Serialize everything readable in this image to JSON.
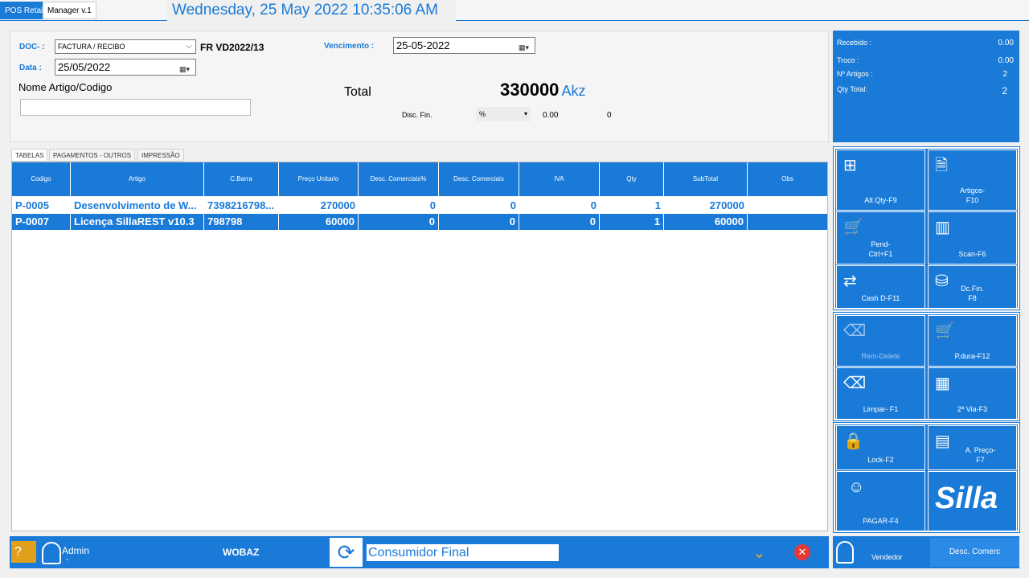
{
  "tabs": [
    "POS Retail",
    "Manager v.1"
  ],
  "clock": "Wednesday, 25 May 2022 10:35:06 AM",
  "header": {
    "doc_label": "DOC- :",
    "doc_type": "FACTURA / RECIBO",
    "doc_number": "FR VD2022/13",
    "data_label": "Data :",
    "data_value": "25/05/2022",
    "vencimento_label": "Vencimento :",
    "vencimento_value": "25-05-2022",
    "search_label": "Nome Artigo/Codigo",
    "search_value": "",
    "total_label": "Total",
    "total_value": "330000",
    "currency": "Akz",
    "disc_label": "Disc. Fin.",
    "disc_type": "%",
    "disc_pct": "0.00",
    "disc_value": "0"
  },
  "info": {
    "recebido_label": "Recebido :",
    "recebido": "0.00",
    "troco_label": "Troco :",
    "troco": "0.00",
    "artigos_label": "Nº Artigos :",
    "artigos": "2",
    "qty_label": "Qty Total:",
    "qty": "2"
  },
  "panel_tabs": [
    "TABELAS",
    "PAGAMENTOS - OUTROS",
    "IMPRESSÃO"
  ],
  "table": {
    "columns": [
      "Codigo",
      "Artigo",
      "C.Barra",
      "Preço Unitario",
      "Desc. Comerciais%",
      "Desc. Comerciais",
      "IVA",
      "Qty",
      "SubTotal",
      "Obs"
    ],
    "rows": [
      {
        "codigo": "P-0005",
        "artigo": "Desenvolvimento de W...",
        "barra": "7398216798...",
        "preco": "270000",
        "desc_pct": "0",
        "desc": "0",
        "iva": "0",
        "qty": "1",
        "subtotal": "270000",
        "obs": ""
      },
      {
        "codigo": "P-0007",
        "artigo": "Licença SillaREST v10.3",
        "barra": "798798",
        "preco": "60000",
        "desc_pct": "0",
        "desc": "0",
        "iva": "0",
        "qty": "1",
        "subtotal": "60000",
        "obs": ""
      }
    ]
  },
  "buttons": {
    "altqty": "Alt.Qty-F9",
    "artigos": "Artigos-\nF10",
    "pend": "Pend-\nCtrl+F1",
    "scan": "Scan-F6",
    "cashd": "Cash D-F11",
    "dcfin": "Dc.Fin.\nF8",
    "remdelete": "Rem-Delete",
    "pdura": "P.dura-F12",
    "limpar": "Limpar- F1",
    "segunda": "2ª Via-F3",
    "lock": "Lock-F2",
    "apreco": "A. Preço-\nF7",
    "pagar": "PAGAR-F4",
    "logo": "Silla"
  },
  "bottom": {
    "help": "?",
    "user": "Admin",
    "user_sub": "-",
    "company": "WOBAZ",
    "customer": "Consumidor Final",
    "vendor": "Vendedor",
    "desc_comerc": "Desc. Comerc"
  },
  "colors": {
    "accent": "#1a7ad8",
    "help": "#e0a019",
    "cancel": "#e53935",
    "confirm": "#e08a1e"
  }
}
